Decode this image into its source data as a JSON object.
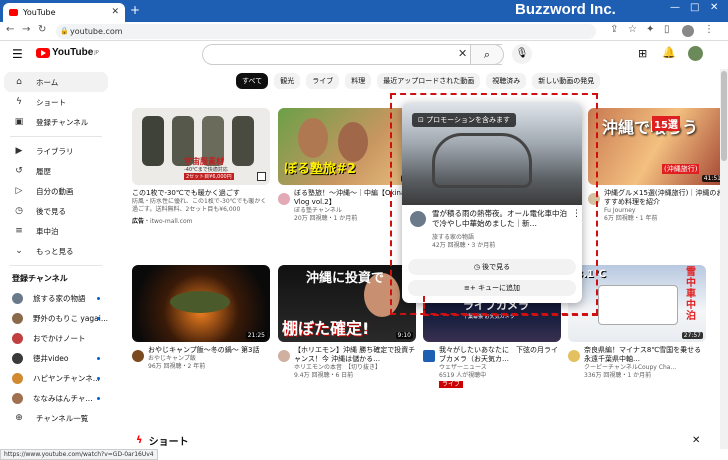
{
  "browser": {
    "tab_title": "YouTube",
    "url": "youtube.com",
    "status_url": "https://www.youtube.com/watch?v=GD-0ar16Uv4",
    "watermark": "Buzzword Inc.",
    "new_tab": "+",
    "tab_close": "✕"
  },
  "header": {
    "logo": "YouTube",
    "logo_suffix": "JP"
  },
  "chips": [
    "すべて",
    "観光",
    "ライブ",
    "料理",
    "最近アップロードされた動画",
    "視聴済み",
    "新しい動画の発見"
  ],
  "sidebar": {
    "main": [
      {
        "label": "ホーム",
        "icon": "home-icon"
      },
      {
        "label": "ショート",
        "icon": "shorts-icon"
      },
      {
        "label": "登録チャンネル",
        "icon": "subscriptions-icon"
      }
    ],
    "library": [
      {
        "label": "ライブラリ",
        "icon": "library-icon"
      },
      {
        "label": "履歴",
        "icon": "history-icon"
      },
      {
        "label": "自分の動画",
        "icon": "my-videos-icon"
      },
      {
        "label": "後で見る",
        "icon": "watch-later-icon"
      },
      {
        "label": "車中泊",
        "icon": "playlist-icon"
      },
      {
        "label": "もっと見る",
        "icon": "chevron-down-icon"
      }
    ],
    "subs_heading": "登録チャンネル",
    "subs": [
      {
        "label": "旅する家の物語",
        "color": "#6b7a8a",
        "dot": true
      },
      {
        "label": "野外のもりこ yagai...",
        "color": "#8a6a4a",
        "dot": true
      },
      {
        "label": "おでかけノート",
        "color": "#c04040",
        "dot": false
      },
      {
        "label": "徳井video",
        "color": "#3a3a3a",
        "dot": true
      },
      {
        "label": "ハピヤンチャンネ...",
        "color": "#d08a30",
        "dot": true
      },
      {
        "label": "ななみはんチャ...",
        "color": "#a07050",
        "dot": true
      }
    ],
    "more_channels": "チャンネル一覧"
  },
  "videos": [
    {
      "title": "この1枚で-30℃でも暖かく過ごす",
      "line2": "防風・防水性に優れ、この1枚で-30℃でも暖かく過ごす。送料無料、2セット目も¥6,000",
      "ad_label": "広告",
      "ad_site": "itwo-mall.com",
      "thumb_text": "宇宙服素材",
      "thumb_sub": "-40℃まで快適対応",
      "thumb_price": "2セット目¥6,000円"
    },
    {
      "title": "ぼる塾旅！～沖縄～｜中編【Okinawa Vlog vol.2】",
      "channel": "ぼる塾チャンネル",
      "stats": "20万 回視聴・1 か月前",
      "duration": "29",
      "thumb_text": "ぼる塾旅#2"
    },
    {
      "title": "雪が積る雨の熱帯夜。オール電化車中泊で冷やし中華始めました｜新…",
      "channel": "旅する家の物語",
      "stats": "42万 回視聴・3 か月前",
      "promo": "プロモーションを含みます"
    },
    {
      "title": "沖縄グルメ15選(沖縄旅行)｜沖縄のおすすめ料理を紹介",
      "channel": "Fu Journey",
      "stats": "6万 回視聴・1 年前",
      "duration": "41:51",
      "thumb_text": "沖縄で喰らう",
      "thumb_badge": "15選",
      "thumb_tag": "(沖縄旅行)"
    },
    {
      "title": "おやじキャンプ飯～冬の鍋～ 第3話",
      "channel": "おやじキャンプ飯",
      "stats": "96万 回視聴・2 年前",
      "duration": "21:25"
    },
    {
      "title": "【ホリエモン】沖縄 勝ち確定で投資チャンス！今 沖縄は儲かる…",
      "channel": "ホリエモンの本音　【切り抜き】",
      "stats": "9.4万 回視聴・6 日前",
      "duration": "9:10",
      "thumb_text": "沖縄に投資で",
      "thumb_text2": "棚ぼた確定!"
    },
    {
      "title": "我々がしたいあなたに　下弦の月ライブカメラ（お天気カ…",
      "channel": "ウェザーニュース",
      "stats": "6519 人が視聴中",
      "live": "ライブ",
      "thumb_text": "ライブカメラ",
      "thumb_sub": "千葉幕張 お天気カメラ"
    },
    {
      "title": "奈良県編！マイナス8℃雪国を乗せる永遠千葉県中軸…",
      "channel": "クーピーチャンネルCoupy Cha...",
      "stats": "336万 回視聴・1 か月前",
      "duration": "27:57",
      "thumb_text": "雪中車中泊",
      "thumb_temp": "-8.1℃"
    }
  ],
  "popup": {
    "watch_later": "後で見る",
    "add_queue": "キューに追加"
  },
  "shorts_heading": "ショート"
}
